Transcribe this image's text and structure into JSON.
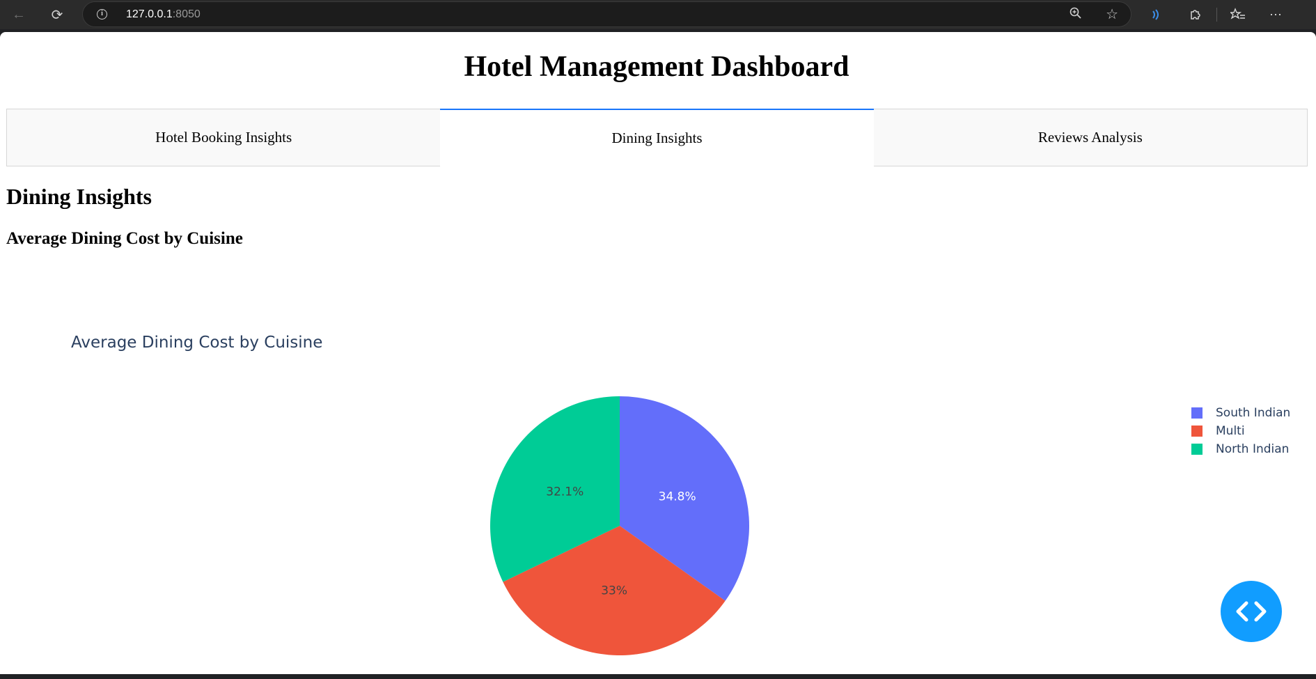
{
  "browser": {
    "url_host": "127.0.0.1",
    "url_port": ":8050"
  },
  "page": {
    "title": "Hotel Management Dashboard",
    "tabs": [
      {
        "label": "Hotel Booking Insights",
        "active": false
      },
      {
        "label": "Dining Insights",
        "active": true
      },
      {
        "label": "Reviews Analysis",
        "active": false
      }
    ],
    "section_title": "Dining Insights",
    "sub_title": "Average Dining Cost by Cuisine"
  },
  "chart_data": {
    "type": "pie",
    "title": "Average Dining Cost by Cuisine",
    "categories": [
      "South Indian",
      "Multi",
      "North Indian"
    ],
    "values": [
      34.8,
      33.0,
      32.1
    ],
    "labels": [
      "34.8%",
      "33%",
      "32.1%"
    ],
    "colors": [
      "#636efa",
      "#EF553B",
      "#00cc96"
    ],
    "label_colors": [
      "#ffffff",
      "#444444",
      "#444444"
    ],
    "legend_position": "top-right"
  },
  "icons": {
    "back": "arrow-left-icon",
    "reload": "reload-icon",
    "info": "info-icon",
    "zoom": "zoom-icon",
    "favorite": "star-icon",
    "read_aloud": "read-aloud-icon",
    "extensions": "puzzle-icon",
    "favorites": "favorites-list-icon",
    "menu": "more-icon",
    "debug": "code-icon"
  }
}
